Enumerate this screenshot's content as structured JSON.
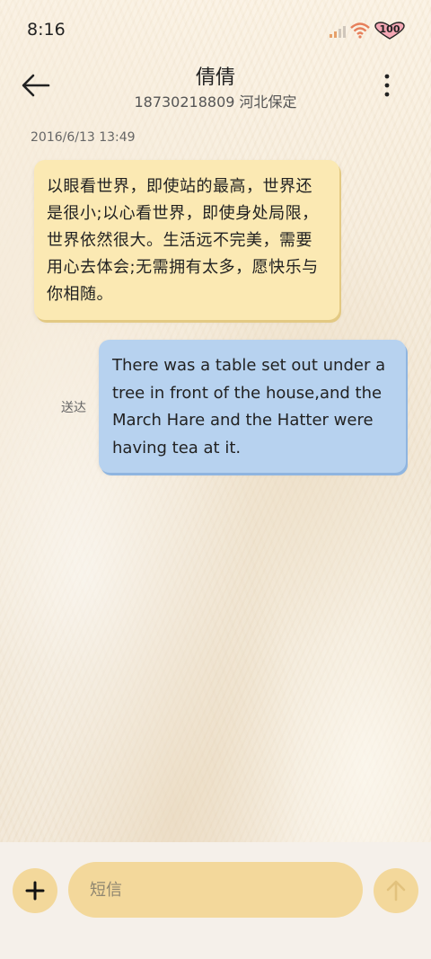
{
  "status_bar": {
    "time": "8:16",
    "battery": "100",
    "icons": [
      "signal-icon",
      "wifi-icon",
      "battery-icon"
    ]
  },
  "header": {
    "contact_name": "倩倩",
    "contact_sub": "18730218809 河北保定",
    "icons": [
      "back-arrow-icon",
      "more-vertical-icon"
    ]
  },
  "conversation": {
    "timestamp": "2016/6/13 13:49",
    "messages": [
      {
        "direction": "incoming",
        "text": "以眼看世界，即使站的最高，世界还是很小;以心看世界，即使身处局限，世界依然很大。生活远不完美，需要用心去体会;无需拥有太多，愿快乐与你相随。"
      },
      {
        "direction": "outgoing",
        "text": "There was a table set out under a tree in front of the house,and the March Hare and the Hatter were having tea at it.",
        "status": "送达"
      }
    ]
  },
  "composer": {
    "placeholder": "短信",
    "icons": [
      "plus-icon",
      "send-arrow-up-icon"
    ]
  },
  "colors": {
    "incoming_bubble": "#fbe9b3",
    "outgoing_bubble": "#b7d2ef",
    "accent_button": "#f3d89b"
  }
}
